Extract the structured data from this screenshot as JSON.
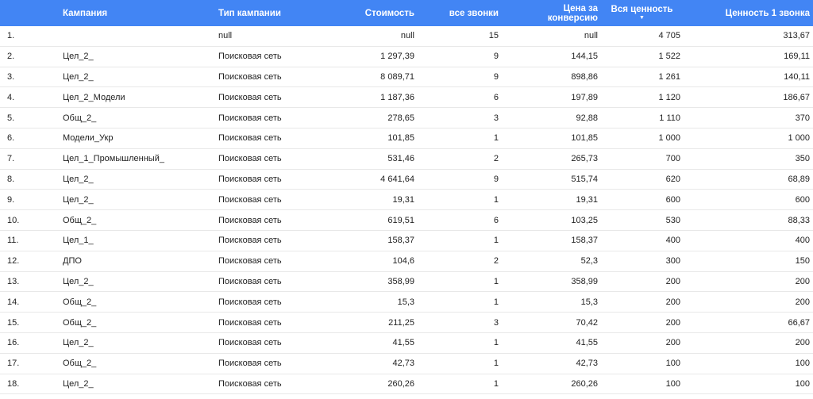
{
  "header": {
    "campaign": "Кампания",
    "campaign_type": "Тип кампании",
    "cost": "Стоимость",
    "all_calls": "все звонки",
    "cost_per_conversion_line1": "Цена за",
    "cost_per_conversion_line2": "конверсию",
    "total_value": "Вся ценность",
    "value_per_call": "Ценность 1 звонка"
  },
  "sort": {
    "column": "total_value",
    "direction": "desc",
    "icon": "sort-down-arrow"
  },
  "colors": {
    "header_bg": "#4285f4",
    "header_text": "#ffffff",
    "row_border": "#e8e8e8",
    "text": "#222222"
  },
  "rows": [
    {
      "num": "1.",
      "campaign": "",
      "type": "null",
      "cost": "null",
      "calls": "15",
      "cpc": "null",
      "total": "4 705",
      "per": "313,67"
    },
    {
      "num": "2.",
      "campaign": "Цел_2_",
      "type": "Поисковая сеть",
      "cost": "1 297,39",
      "calls": "9",
      "cpc": "144,15",
      "total": "1 522",
      "per": "169,11"
    },
    {
      "num": "3.",
      "campaign": "Цел_2_",
      "type": "Поисковая сеть",
      "cost": "8 089,71",
      "calls": "9",
      "cpc": "898,86",
      "total": "1 261",
      "per": "140,11"
    },
    {
      "num": "4.",
      "campaign": "Цел_2_Модели",
      "type": "Поисковая сеть",
      "cost": "1 187,36",
      "calls": "6",
      "cpc": "197,89",
      "total": "1 120",
      "per": "186,67"
    },
    {
      "num": "5.",
      "campaign": "Общ_2_",
      "type": "Поисковая сеть",
      "cost": "278,65",
      "calls": "3",
      "cpc": "92,88",
      "total": "1 110",
      "per": "370"
    },
    {
      "num": "6.",
      "campaign": "Модели_Укр",
      "type": "Поисковая сеть",
      "cost": "101,85",
      "calls": "1",
      "cpc": "101,85",
      "total": "1 000",
      "per": "1 000"
    },
    {
      "num": "7.",
      "campaign": "Цел_1_Промышленный_",
      "type": "Поисковая сеть",
      "cost": "531,46",
      "calls": "2",
      "cpc": "265,73",
      "total": "700",
      "per": "350"
    },
    {
      "num": "8.",
      "campaign": "Цел_2_",
      "type": "Поисковая сеть",
      "cost": "4 641,64",
      "calls": "9",
      "cpc": "515,74",
      "total": "620",
      "per": "68,89"
    },
    {
      "num": "9.",
      "campaign": "Цел_2_",
      "type": "Поисковая сеть",
      "cost": "19,31",
      "calls": "1",
      "cpc": "19,31",
      "total": "600",
      "per": "600"
    },
    {
      "num": "10.",
      "campaign": "Общ_2_",
      "type": "Поисковая сеть",
      "cost": "619,51",
      "calls": "6",
      "cpc": "103,25",
      "total": "530",
      "per": "88,33"
    },
    {
      "num": "11.",
      "campaign": "Цел_1_",
      "type": "Поисковая сеть",
      "cost": "158,37",
      "calls": "1",
      "cpc": "158,37",
      "total": "400",
      "per": "400"
    },
    {
      "num": "12.",
      "campaign": "ДПО",
      "type": "Поисковая сеть",
      "cost": "104,6",
      "calls": "2",
      "cpc": "52,3",
      "total": "300",
      "per": "150"
    },
    {
      "num": "13.",
      "campaign": "Цел_2_",
      "type": "Поисковая сеть",
      "cost": "358,99",
      "calls": "1",
      "cpc": "358,99",
      "total": "200",
      "per": "200"
    },
    {
      "num": "14.",
      "campaign": "Общ_2_",
      "type": "Поисковая сеть",
      "cost": "15,3",
      "calls": "1",
      "cpc": "15,3",
      "total": "200",
      "per": "200"
    },
    {
      "num": "15.",
      "campaign": "Общ_2_",
      "type": "Поисковая сеть",
      "cost": "211,25",
      "calls": "3",
      "cpc": "70,42",
      "total": "200",
      "per": "66,67"
    },
    {
      "num": "16.",
      "campaign": "Цел_2_",
      "type": "Поисковая сеть",
      "cost": "41,55",
      "calls": "1",
      "cpc": "41,55",
      "total": "200",
      "per": "200"
    },
    {
      "num": "17.",
      "campaign": "Общ_2_",
      "type": "Поисковая сеть",
      "cost": "42,73",
      "calls": "1",
      "cpc": "42,73",
      "total": "100",
      "per": "100"
    },
    {
      "num": "18.",
      "campaign": "Цел_2_",
      "type": "Поисковая сеть",
      "cost": "260,26",
      "calls": "1",
      "cpc": "260,26",
      "total": "100",
      "per": "100"
    }
  ]
}
